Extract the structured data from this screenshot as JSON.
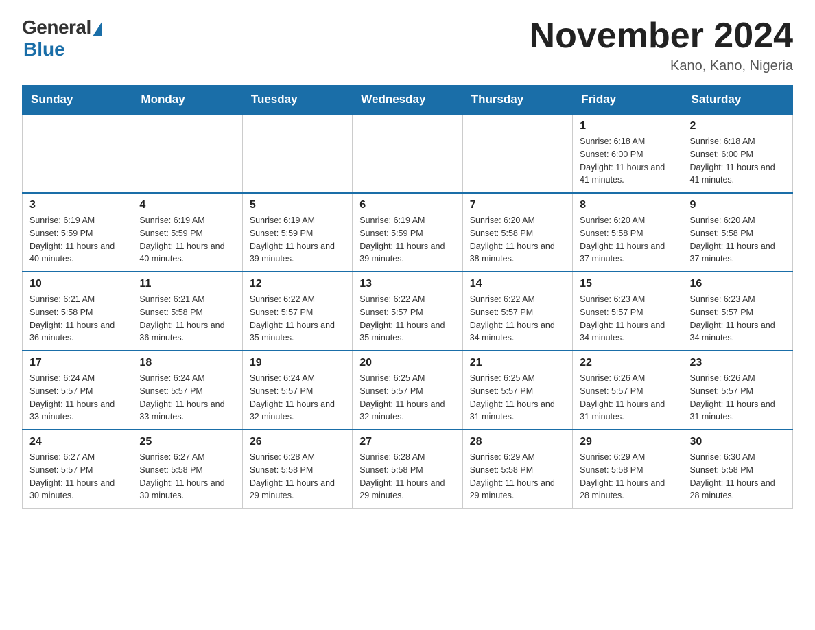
{
  "logo": {
    "general_text": "General",
    "blue_text": "Blue"
  },
  "title": "November 2024",
  "location": "Kano, Kano, Nigeria",
  "days_of_week": [
    "Sunday",
    "Monday",
    "Tuesday",
    "Wednesday",
    "Thursday",
    "Friday",
    "Saturday"
  ],
  "weeks": [
    [
      {
        "day": "",
        "info": ""
      },
      {
        "day": "",
        "info": ""
      },
      {
        "day": "",
        "info": ""
      },
      {
        "day": "",
        "info": ""
      },
      {
        "day": "",
        "info": ""
      },
      {
        "day": "1",
        "info": "Sunrise: 6:18 AM\nSunset: 6:00 PM\nDaylight: 11 hours and 41 minutes."
      },
      {
        "day": "2",
        "info": "Sunrise: 6:18 AM\nSunset: 6:00 PM\nDaylight: 11 hours and 41 minutes."
      }
    ],
    [
      {
        "day": "3",
        "info": "Sunrise: 6:19 AM\nSunset: 5:59 PM\nDaylight: 11 hours and 40 minutes."
      },
      {
        "day": "4",
        "info": "Sunrise: 6:19 AM\nSunset: 5:59 PM\nDaylight: 11 hours and 40 minutes."
      },
      {
        "day": "5",
        "info": "Sunrise: 6:19 AM\nSunset: 5:59 PM\nDaylight: 11 hours and 39 minutes."
      },
      {
        "day": "6",
        "info": "Sunrise: 6:19 AM\nSunset: 5:59 PM\nDaylight: 11 hours and 39 minutes."
      },
      {
        "day": "7",
        "info": "Sunrise: 6:20 AM\nSunset: 5:58 PM\nDaylight: 11 hours and 38 minutes."
      },
      {
        "day": "8",
        "info": "Sunrise: 6:20 AM\nSunset: 5:58 PM\nDaylight: 11 hours and 37 minutes."
      },
      {
        "day": "9",
        "info": "Sunrise: 6:20 AM\nSunset: 5:58 PM\nDaylight: 11 hours and 37 minutes."
      }
    ],
    [
      {
        "day": "10",
        "info": "Sunrise: 6:21 AM\nSunset: 5:58 PM\nDaylight: 11 hours and 36 minutes."
      },
      {
        "day": "11",
        "info": "Sunrise: 6:21 AM\nSunset: 5:58 PM\nDaylight: 11 hours and 36 minutes."
      },
      {
        "day": "12",
        "info": "Sunrise: 6:22 AM\nSunset: 5:57 PM\nDaylight: 11 hours and 35 minutes."
      },
      {
        "day": "13",
        "info": "Sunrise: 6:22 AM\nSunset: 5:57 PM\nDaylight: 11 hours and 35 minutes."
      },
      {
        "day": "14",
        "info": "Sunrise: 6:22 AM\nSunset: 5:57 PM\nDaylight: 11 hours and 34 minutes."
      },
      {
        "day": "15",
        "info": "Sunrise: 6:23 AM\nSunset: 5:57 PM\nDaylight: 11 hours and 34 minutes."
      },
      {
        "day": "16",
        "info": "Sunrise: 6:23 AM\nSunset: 5:57 PM\nDaylight: 11 hours and 34 minutes."
      }
    ],
    [
      {
        "day": "17",
        "info": "Sunrise: 6:24 AM\nSunset: 5:57 PM\nDaylight: 11 hours and 33 minutes."
      },
      {
        "day": "18",
        "info": "Sunrise: 6:24 AM\nSunset: 5:57 PM\nDaylight: 11 hours and 33 minutes."
      },
      {
        "day": "19",
        "info": "Sunrise: 6:24 AM\nSunset: 5:57 PM\nDaylight: 11 hours and 32 minutes."
      },
      {
        "day": "20",
        "info": "Sunrise: 6:25 AM\nSunset: 5:57 PM\nDaylight: 11 hours and 32 minutes."
      },
      {
        "day": "21",
        "info": "Sunrise: 6:25 AM\nSunset: 5:57 PM\nDaylight: 11 hours and 31 minutes."
      },
      {
        "day": "22",
        "info": "Sunrise: 6:26 AM\nSunset: 5:57 PM\nDaylight: 11 hours and 31 minutes."
      },
      {
        "day": "23",
        "info": "Sunrise: 6:26 AM\nSunset: 5:57 PM\nDaylight: 11 hours and 31 minutes."
      }
    ],
    [
      {
        "day": "24",
        "info": "Sunrise: 6:27 AM\nSunset: 5:57 PM\nDaylight: 11 hours and 30 minutes."
      },
      {
        "day": "25",
        "info": "Sunrise: 6:27 AM\nSunset: 5:58 PM\nDaylight: 11 hours and 30 minutes."
      },
      {
        "day": "26",
        "info": "Sunrise: 6:28 AM\nSunset: 5:58 PM\nDaylight: 11 hours and 29 minutes."
      },
      {
        "day": "27",
        "info": "Sunrise: 6:28 AM\nSunset: 5:58 PM\nDaylight: 11 hours and 29 minutes."
      },
      {
        "day": "28",
        "info": "Sunrise: 6:29 AM\nSunset: 5:58 PM\nDaylight: 11 hours and 29 minutes."
      },
      {
        "day": "29",
        "info": "Sunrise: 6:29 AM\nSunset: 5:58 PM\nDaylight: 11 hours and 28 minutes."
      },
      {
        "day": "30",
        "info": "Sunrise: 6:30 AM\nSunset: 5:58 PM\nDaylight: 11 hours and 28 minutes."
      }
    ]
  ]
}
